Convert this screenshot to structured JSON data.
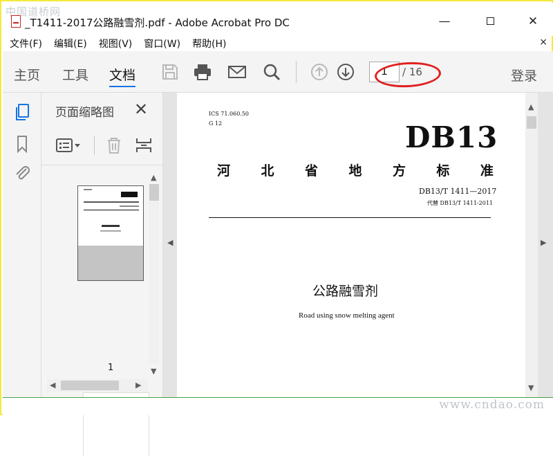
{
  "watermark": {
    "top": "中国道桥网",
    "bottom": "www.cndao.com"
  },
  "window": {
    "title": "_T1411-2017公路融雪剂.pdf - Adobe Acrobat Pro DC",
    "minimize": "—",
    "maximize": "",
    "close": "✕"
  },
  "menu": {
    "items": [
      "文件(F)",
      "编辑(E)",
      "视图(V)",
      "窗口(W)",
      "帮助(H)"
    ],
    "close": "×"
  },
  "toolbar": {
    "tabs": [
      "主页",
      "工具",
      "文档"
    ],
    "active_tab": "文档",
    "page_current": "1",
    "page_total": "/ 16",
    "login": "登录"
  },
  "thumbnails": {
    "title": "页面缩略图",
    "close": "✕",
    "page_label": "1"
  },
  "document": {
    "ics": "ICS 71.060.50",
    "gcode": "G 12",
    "code": "DB13",
    "province_chars": [
      "河",
      "北",
      "省",
      "地",
      "方",
      "标",
      "准"
    ],
    "standard_number": "DB13/T 1411—2017",
    "supersede": "代替 DB13/T 1411-2011",
    "title": "公路融雪剂",
    "subtitle": "Road using snow melting agent"
  },
  "colors": {
    "accent": "#1473e6",
    "highlight_ellipse": "#e02020",
    "frame": "#f5ea3b"
  }
}
